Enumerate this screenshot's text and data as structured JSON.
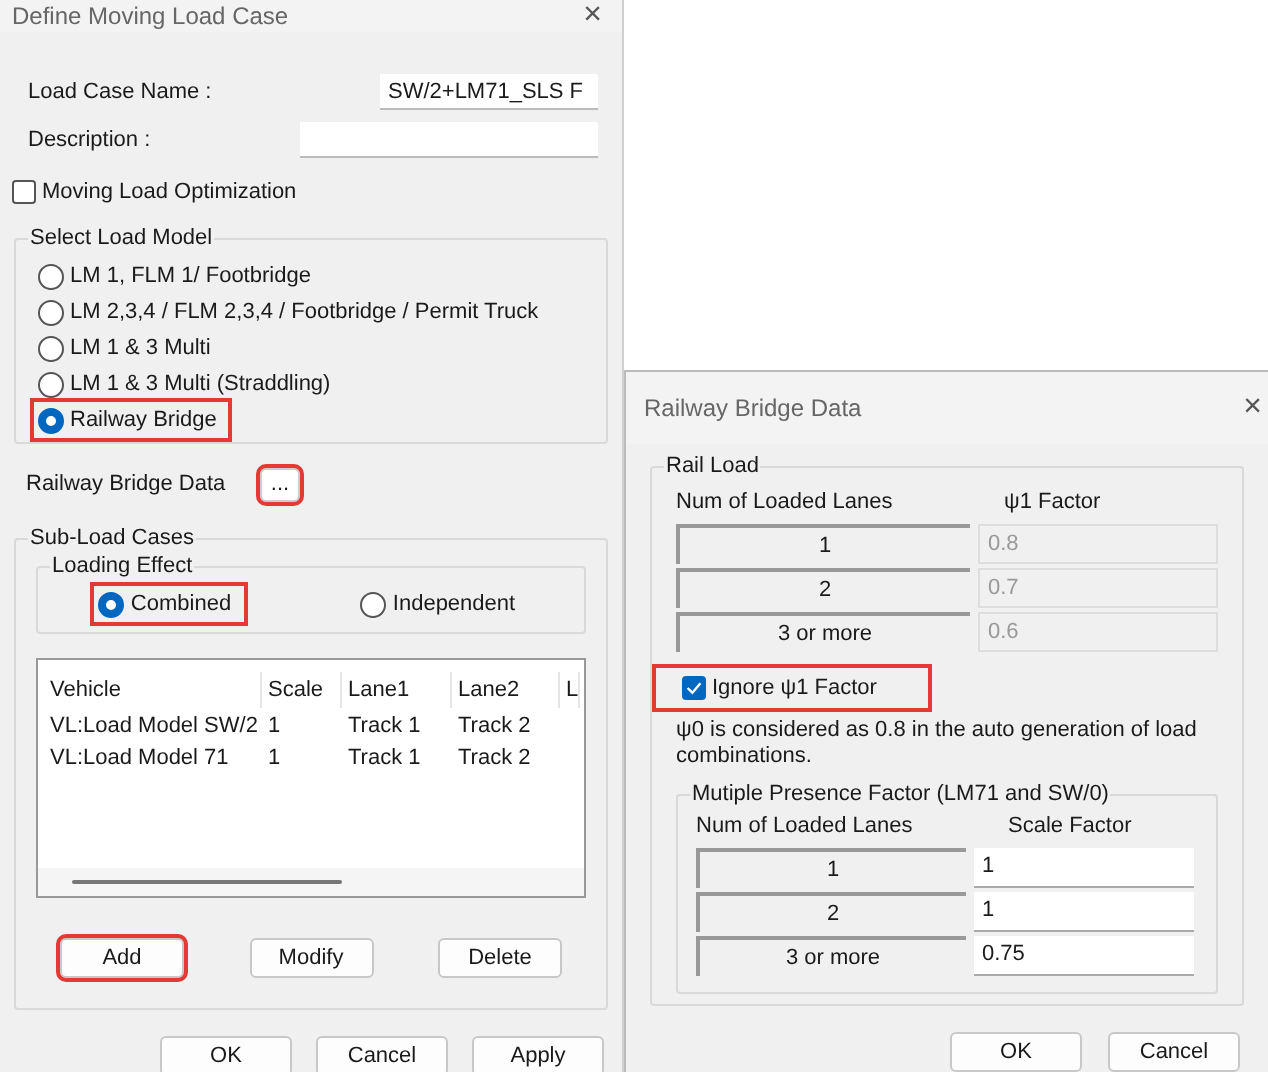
{
  "main_dialog": {
    "title": "Define Moving Load Case",
    "close": "×",
    "fields": [
      {
        "label": "Load Case Name  :",
        "value": "SW/2+LM71_SLS F"
      },
      {
        "label": "Description :"
      }
    ],
    "optimization": {
      "label": "Moving Load Optimization",
      "checked": false
    },
    "load_model": {
      "title": "Select Load Model",
      "options": [
        {
          "label": "LM 1, FLM 1/ Footbridge",
          "selected": false,
          "highlighted": false
        },
        {
          "label": "LM 2,3,4 / FLM 2,3,4 / Footbridge / Permit Truck",
          "selected": false,
          "highlighted": false
        },
        {
          "label": "LM 1 & 3 Multi",
          "selected": false,
          "highlighted": false
        },
        {
          "label": "LM 1 & 3 Multi (Straddling)",
          "selected": false,
          "highlighted": false
        },
        {
          "label": "Railway Bridge",
          "selected": true,
          "highlighted": true
        }
      ]
    },
    "railway_data": {
      "label": "Railway Bridge Data",
      "button": "...",
      "highlighted": true
    },
    "sub_load_cases": {
      "title": "Sub-Load Cases",
      "loading_effect": {
        "title": "Loading Effect",
        "options": [
          {
            "label": "Combined",
            "selected": true,
            "highlighted": true
          },
          {
            "label": "Independent",
            "selected": false,
            "highlighted": false
          }
        ]
      },
      "table": {
        "columns": [
          "Vehicle",
          "Scale",
          "Lane1",
          "Lane2",
          "L"
        ],
        "rows": [
          [
            "VL:Load Model SW/2",
            "1",
            "Track 1",
            "Track 2"
          ],
          [
            "VL:Load Model 71",
            "1",
            "Track 1",
            "Track 2"
          ]
        ]
      },
      "buttons": [
        {
          "label": "Add",
          "highlighted": true
        },
        {
          "label": "Modify",
          "highlighted": false
        },
        {
          "label": "Delete",
          "highlighted": false
        }
      ]
    },
    "buttons": [
      "OK",
      "Cancel",
      "Apply"
    ]
  },
  "railway_dialog": {
    "title": "Railway Bridge Data",
    "close": "×",
    "rail_load": {
      "title": "Rail Load",
      "columns": [
        "Num of Loaded Lanes",
        "ψ1 Factor"
      ],
      "rows": [
        {
          "lanes": "1",
          "factor": "0.8"
        },
        {
          "lanes": "2",
          "factor": "0.7"
        },
        {
          "lanes": "3 or more",
          "factor": "0.6"
        }
      ],
      "disabled": true
    },
    "ignore": {
      "label": "Ignore ψ1 Factor",
      "checked": true,
      "highlighted": true
    },
    "note": "ψ0 is considered as 0.8 in the auto generation of load combinations.",
    "presence": {
      "title": "Mutiple Presence Factor (LM71 and SW/0)",
      "columns": [
        "Num of Loaded Lanes",
        "Scale Factor"
      ],
      "rows": [
        {
          "lanes": "1",
          "factor": "1"
        },
        {
          "lanes": "2",
          "factor": "1"
        },
        {
          "lanes": "3 or more",
          "factor": "0.75"
        }
      ]
    },
    "buttons": [
      "OK",
      "Cancel"
    ]
  }
}
